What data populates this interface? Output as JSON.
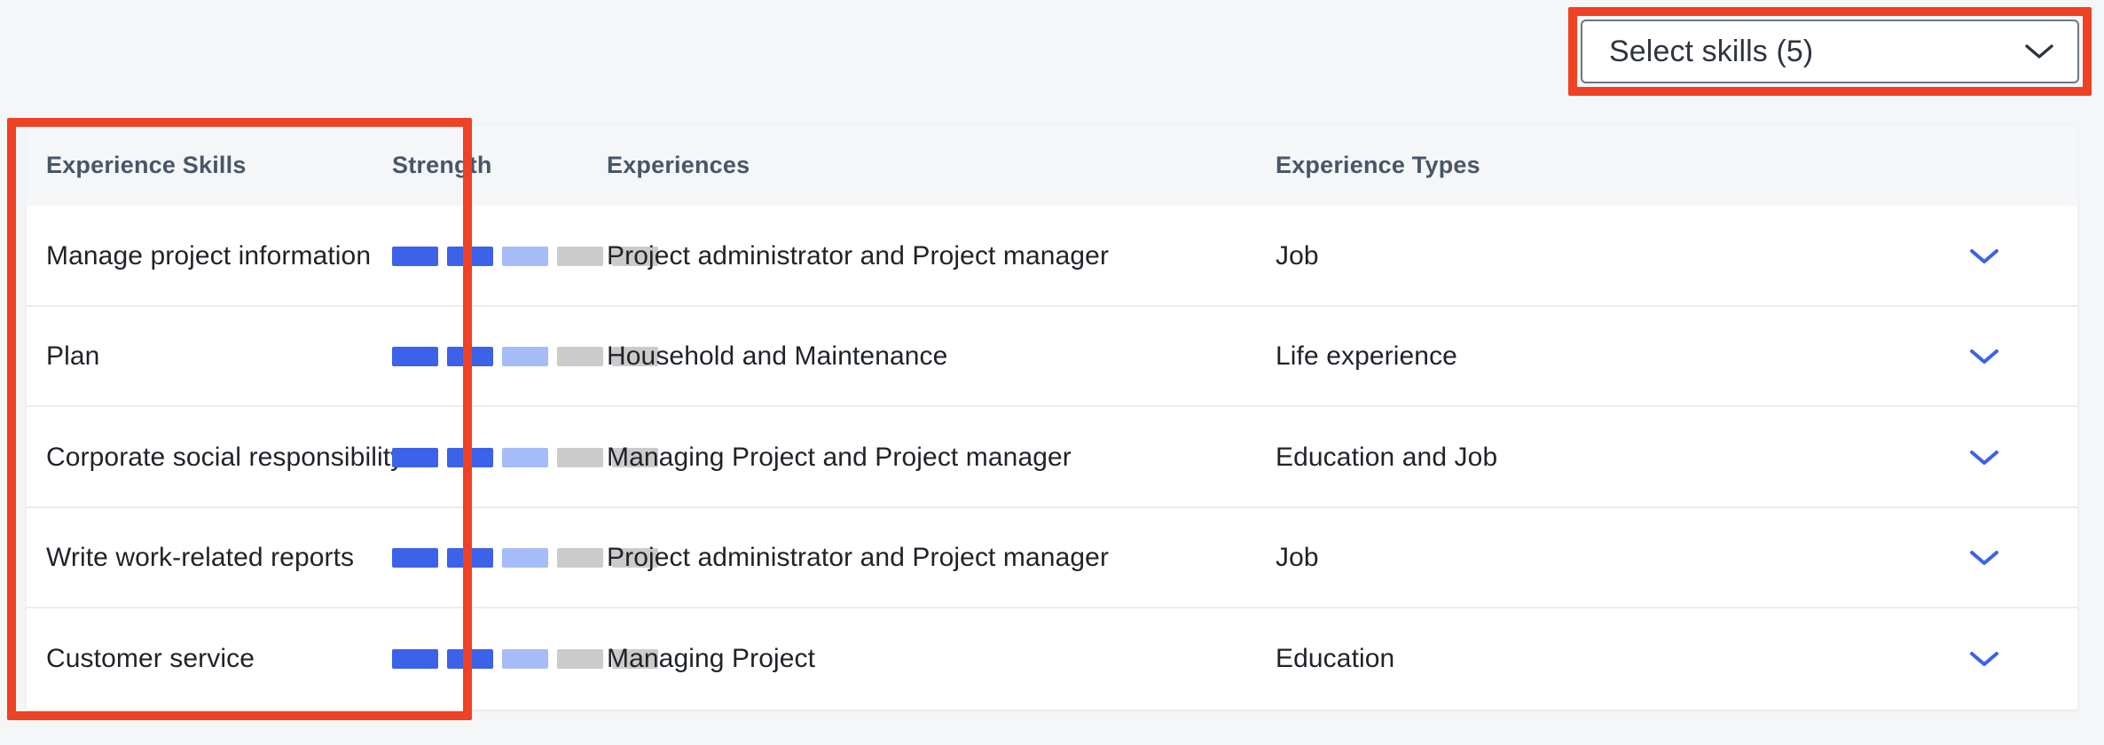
{
  "select_control": {
    "label": "Select skills (5)",
    "icon": "chevron-down-icon",
    "selected_count": 5
  },
  "table": {
    "columns": [
      {
        "key": "skill",
        "label": "Experience Skills"
      },
      {
        "key": "strength",
        "label": "Strength"
      },
      {
        "key": "exp",
        "label": "Experiences"
      },
      {
        "key": "types",
        "label": "Experience Types"
      }
    ],
    "rows": [
      {
        "skill": "Manage project information",
        "strength": {
          "filled": 2,
          "half": 1,
          "empty": 2,
          "total": 5
        },
        "experiences": "Project administrator and Project manager",
        "experience_types": "Job",
        "expand_icon": "chevron-down-icon"
      },
      {
        "skill": "Plan",
        "strength": {
          "filled": 2,
          "half": 1,
          "empty": 2,
          "total": 5
        },
        "experiences": "Household and Maintenance",
        "experience_types": "Life experience",
        "expand_icon": "chevron-down-icon"
      },
      {
        "skill": "Corporate social responsibility",
        "strength": {
          "filled": 2,
          "half": 1,
          "empty": 2,
          "total": 5
        },
        "experiences": "Managing Project and Project manager",
        "experience_types": "Education and Job",
        "expand_icon": "chevron-down-icon"
      },
      {
        "skill": "Write work-related reports",
        "strength": {
          "filled": 2,
          "half": 1,
          "empty": 2,
          "total": 5
        },
        "experiences": "Project administrator and Project manager",
        "experience_types": "Job",
        "expand_icon": "chevron-down-icon"
      },
      {
        "skill": "Customer service",
        "strength": {
          "filled": 2,
          "half": 1,
          "empty": 2,
          "total": 5
        },
        "experiences": "Managing Project",
        "experience_types": "Education",
        "expand_icon": "chevron-down-icon"
      }
    ]
  },
  "annotations": [
    {
      "name": "experience-skills-column-highlight",
      "color": "#EF4123"
    },
    {
      "name": "select-skills-highlight",
      "color": "#EF4123"
    }
  ],
  "colors": {
    "accent_blue": "#3B62E8",
    "accent_blue_light": "#A6BCF8",
    "bar_empty": "#CBCBCB",
    "annotation_red": "#EF4123",
    "page_background": "#F4F6F8",
    "header_text": "#4A5568"
  }
}
